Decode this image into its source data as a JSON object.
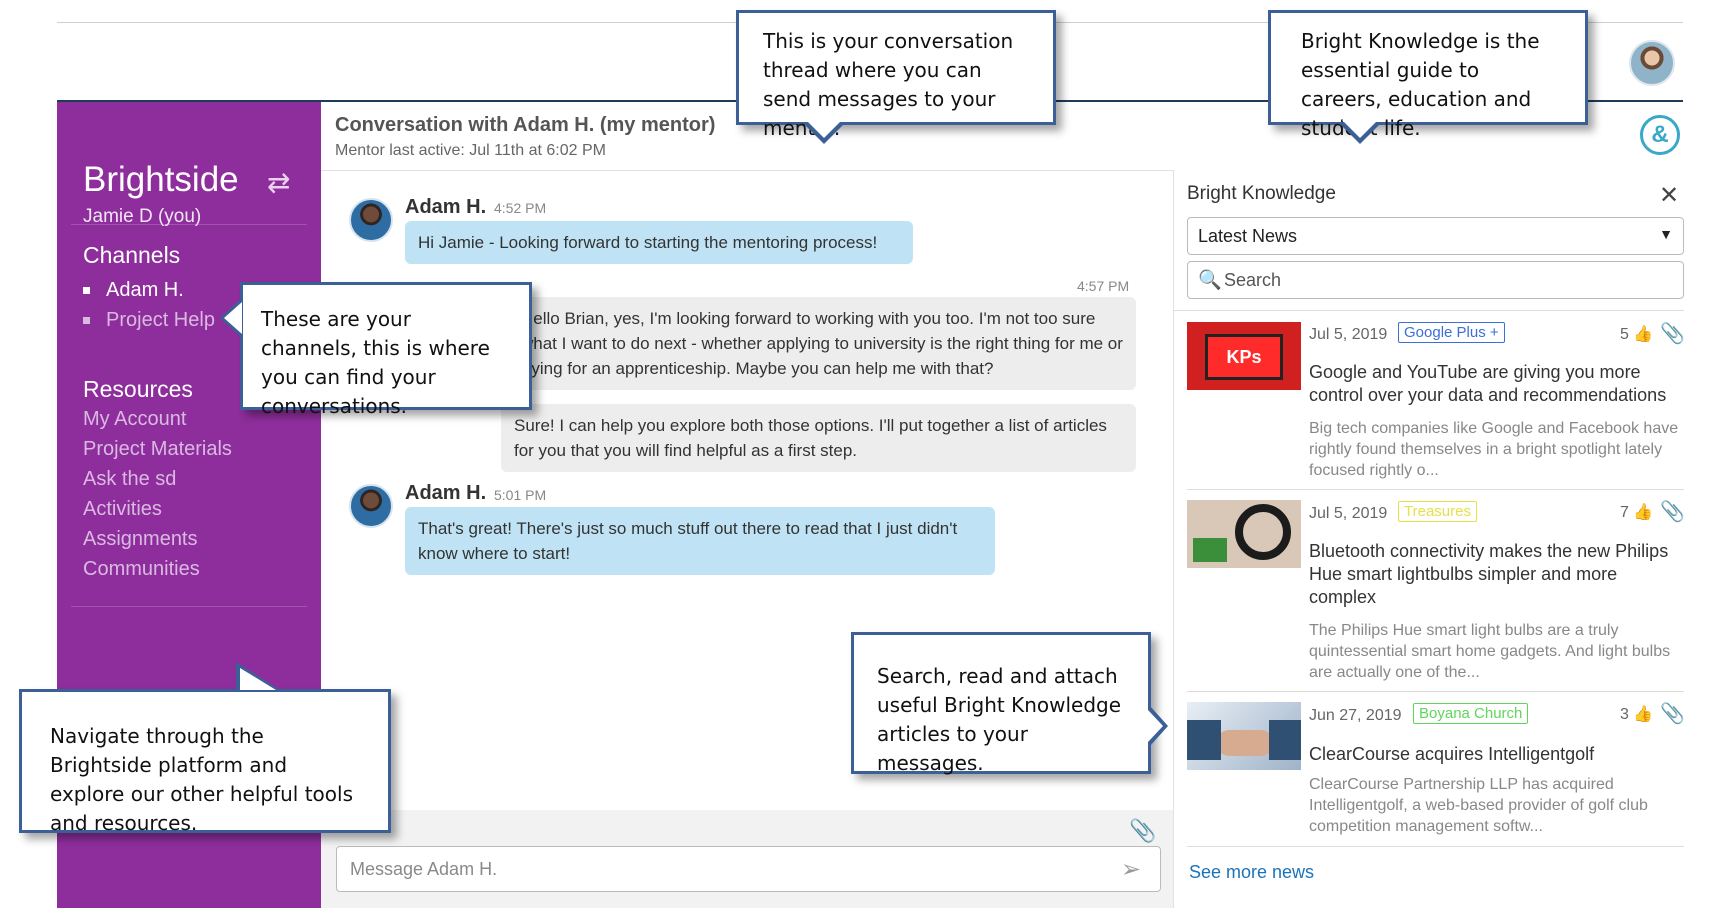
{
  "app": {
    "brand": "Brightside",
    "current_user": "Jamie D (you)"
  },
  "sidebar": {
    "channels_title": "Channels",
    "channels": [
      {
        "label": "Adam H.",
        "active": true
      },
      {
        "label": "Project Help",
        "active": false
      }
    ],
    "resources_title": "Resources",
    "resources": [
      "My Account",
      "Project Materials",
      "Ask the sd",
      "Activities",
      "Assignments",
      "Communities"
    ]
  },
  "conversation": {
    "title": "Conversation with Adam H. (my mentor)",
    "subtitle": "Mentor last active: Jul 11th at 6:02 PM",
    "messages": [
      {
        "author": "Adam H.",
        "time": "4:52 PM",
        "text": "Hi Jamie - Looking forward to starting the mentoring process!"
      },
      {
        "time": "4:57 PM",
        "text": "Hello Brian, yes, I'm looking forward to working with you too.  I'm not too sure what I want to do next - whether applying to university is the right thing for me or trying for an apprenticeship.  Maybe you can help me with that?"
      },
      {
        "text": "Sure! I can help you explore both those options.  I'll put together a list of articles for you that you will find helpful as a first step."
      },
      {
        "author": "Adam H.",
        "time": "5:01 PM",
        "text": "That's great! There's just so much stuff out there to read that I just didn't know where to start!"
      }
    ],
    "composer_placeholder": "Message Adam H."
  },
  "knowledge_panel": {
    "title": "Bright Knowledge",
    "filter_selected": "Latest News",
    "search_placeholder": "Search",
    "articles": [
      {
        "date": "Jul 5, 2019",
        "tag": "Google Plus +",
        "tag_color": "#3b6fd8",
        "likes": "5",
        "title": "Google and YouTube are giving you more control over your data and recommendations",
        "excerpt": "Big tech companies like Google and Facebook have rightly found themselves in a bright spotlight lately focused rightly o..."
      },
      {
        "date": "Jul 5, 2019",
        "tag": "Treasures",
        "tag_color": "#e6e04a",
        "likes": "7",
        "title": "Bluetooth connectivity makes the new Philips Hue smart lightbulbs simpler and more complex",
        "excerpt": "The Philips Hue smart light bulbs are a truly quintessential smart home gadgets. And light bulbs are actually one of the..."
      },
      {
        "date": "Jun 27, 2019",
        "tag": "Boyana Church",
        "tag_color": "#5fd65a",
        "likes": "3",
        "title": "ClearCourse acquires Intelligentgolf",
        "excerpt": "ClearCourse Partnership LLP has acquired Intelligentgolf, a web-based provider of golf club competition management softw..."
      }
    ],
    "see_more": "See more news"
  },
  "callouts": {
    "thread": "This is your conversation thread where you can send messages to your mentor.",
    "knowledge": "Bright Knowledge is the essential guide to careers, education and student life.",
    "channels": "These are your channels, this is where you can find your conversations.",
    "navigate": "Navigate through the Brightside platform and explore our other helpful tools and resources.",
    "articles": "Search, read and attach useful Bright Knowledge articles to your messages."
  },
  "icons": {
    "switch": "swap-arrows-icon",
    "close": "close-icon",
    "search": "search-icon",
    "attach": "paperclip-icon",
    "send": "send-icon",
    "like": "thumbs-up-icon",
    "logo": "bright-knowledge-logo-icon"
  },
  "colors": {
    "sidebar": "#8e2e9c",
    "incoming_bubble": "#bfe3f4",
    "outgoing_bubble": "#ededed",
    "callout_border": "#3d5f97",
    "link": "#1a73b8"
  }
}
